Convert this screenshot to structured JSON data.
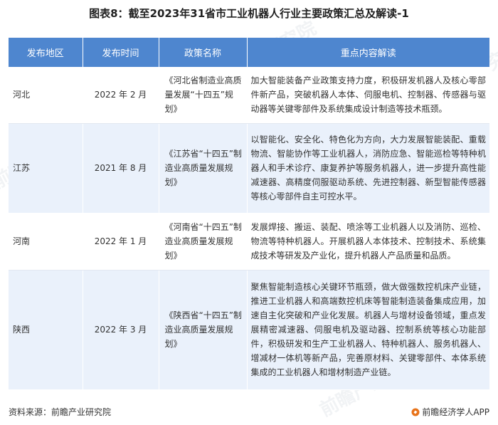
{
  "title": "图表8：截至2023年31省市工业机器人行业主要政策汇总及解读-1",
  "table": {
    "headers": [
      "发布地区",
      "发布时间",
      "政策名称",
      "重点内容解读"
    ],
    "rows": [
      {
        "region": "河北",
        "time": "2022 年 2 月",
        "name": "《河北省制造业高质量发展“十四五”规划》",
        "content": "加大智能装备产业政策支持力度，积极研发机器人及核心零部件新产品，突破机器人本体、伺服电机、控制器、传感器与驱动器等关键零部件及系统集成设计制造等技术瓶颈。"
      },
      {
        "region": "江苏",
        "time": "2021 年 8 月",
        "name": "《江苏省“十四五”制造业高质量发展规划》",
        "content": "以智能化、安全化、特色化为方向，大力发展智能装配、重载物流、智能协作等工业机器人，消防应急、智能巡检等特种机器人和手术诊疗、康复养护等服务机器人，进一步提升高性能减速器、高精度伺服驱动系统、先进控制器、新型智能传感器等核心零部件自主可控水平。"
      },
      {
        "region": "河南",
        "time": "2022 年 1 月",
        "name": "《河南省“十四五”制造业高质量发展规划》",
        "content": "发展焊接、搬运、装配、喷涂等工业机器人以及消防、巡检、物流等特种机器人。开展机器人本体技术、控制技术、系统集成技术等研发及产业化，提升机器人产品质量和品质。"
      },
      {
        "region": "陕西",
        "time": "2022 年 3 月",
        "name": "《陕西省“十四五”制造业高质量发展规划》",
        "content": "聚焦智能制造核心关键环节瓶颈，做大做强数控机床产业链，推进工业机器人和高端数控机床等智能制造装备集成应用，加速自主化突破和产业化发展。机器人与增材设备领域，重点发展精密减速器、伺服电机及驱动器、控制系统等核心功能部件，积极研发和生产工业机器人、特种机器人、服务机器人、增减材一体机等新产品，完善原材料、关键零部件、本体系统集成的工业机器人和增材制造产业链。"
      }
    ]
  },
  "footer": {
    "source": "资料来源：前瞻产业研究院",
    "brand": "前瞻经济学人APP"
  },
  "watermark": "前瞻产业研究院",
  "colors": {
    "header_bg": "#4e86cf",
    "stripe_bg": "#eaf1fb",
    "brand_orange": "#e8731a"
  }
}
